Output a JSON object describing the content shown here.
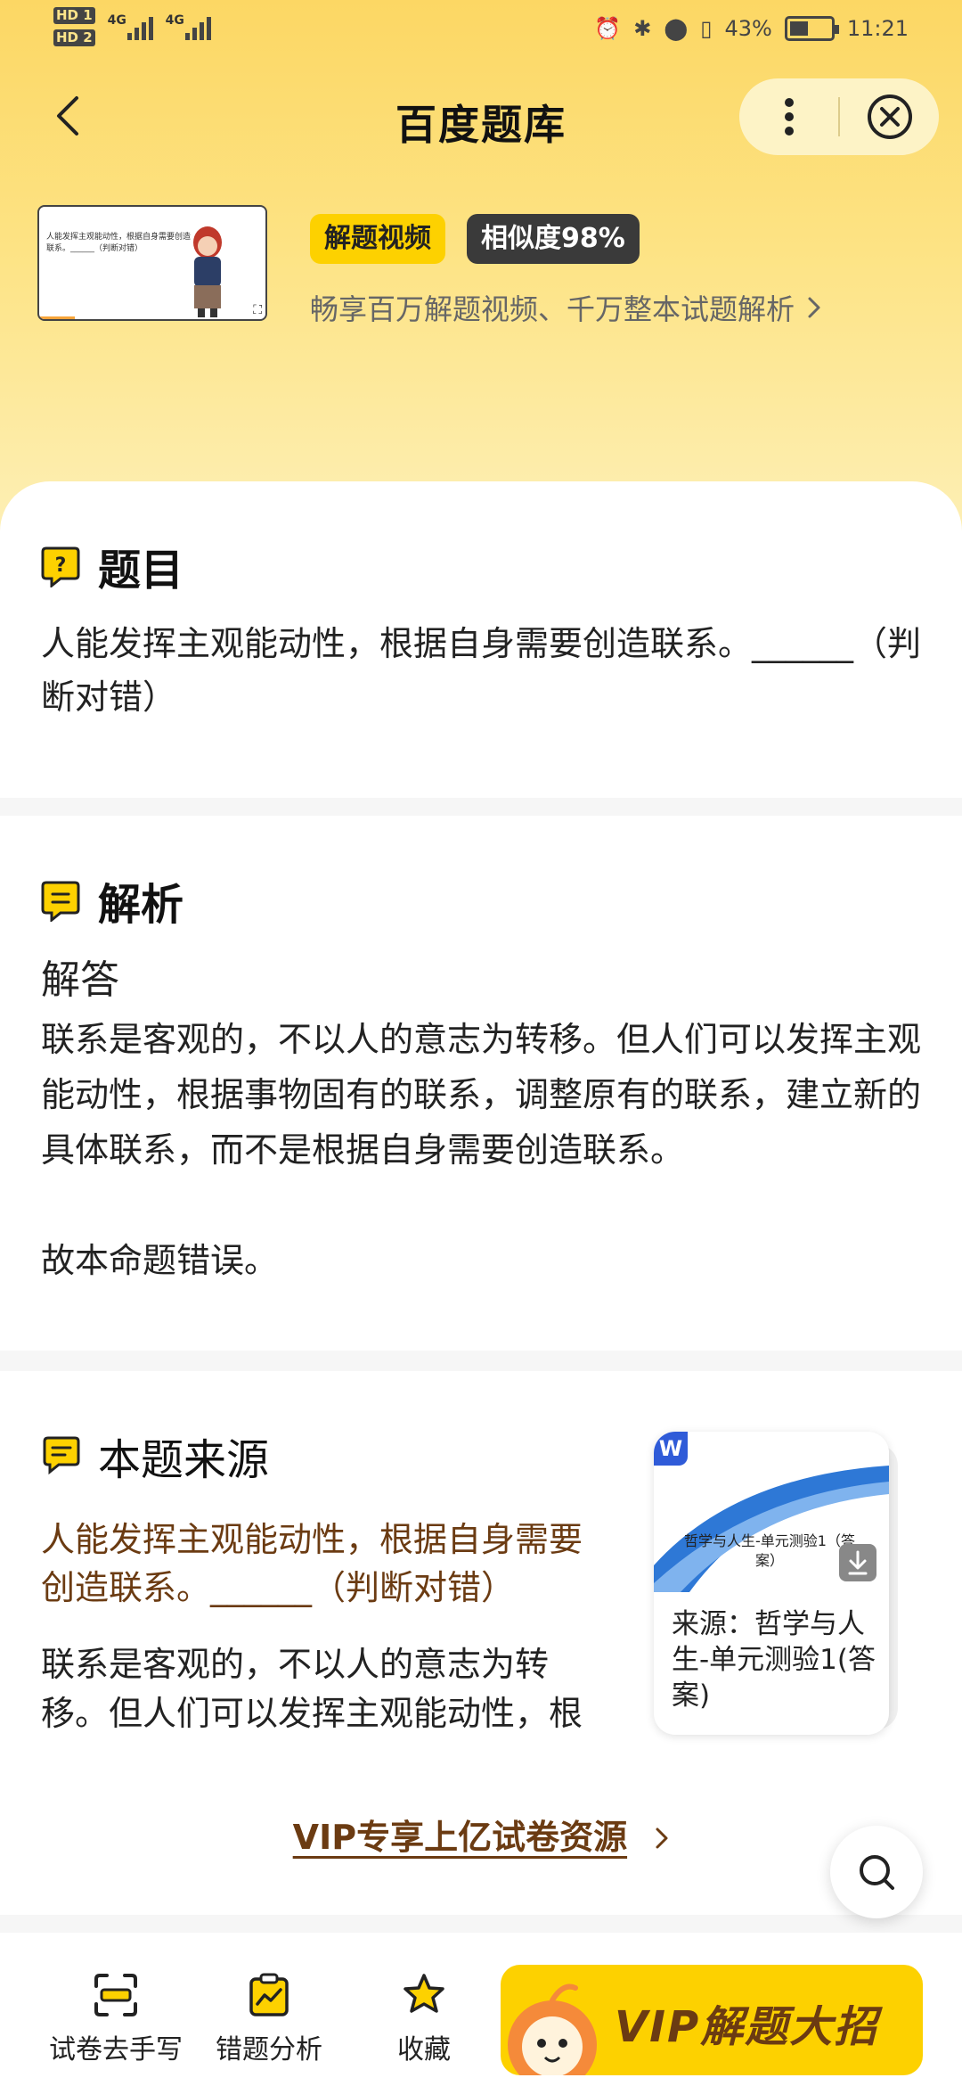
{
  "status_bar": {
    "hd1": "HD 1",
    "hd2": "HD 2",
    "net1": "4G",
    "net2": "4G",
    "battery": "43%",
    "time": "11:21"
  },
  "header": {
    "title": "百度题库",
    "back_icon": "chevron-left-icon",
    "more_icon": "more-vertical-icon",
    "close_icon": "close-circle-icon"
  },
  "video": {
    "thumb_text": "人能发挥主观能动性，根据自身需要创造联系。______（判断对错）",
    "tag_video": "解题视频",
    "tag_similarity": "相似度98%",
    "promo": "畅享百万解题视频、千万整本试题解析"
  },
  "question": {
    "heading": "题目",
    "text": "人能发挥主观能动性，根据自身需要创造联系。______（判断对错）"
  },
  "analysis": {
    "heading": "解析",
    "answer_label": "解答",
    "body": "联系是客观的，不以人的意志为转移。但人们可以发挥主观能动性，根据事物固有的联系，调整原有的联系，建立新的具体联系，而不是根据自身需要创造联系。",
    "conclusion": "故本命题错误。"
  },
  "source": {
    "heading": "本题来源",
    "stem": "人能发挥主观能动性，根据自身需要创造联系。______（判断对错）",
    "analysis_preview": "联系是客观的，不以人的意志为转移。但人们可以发挥主观能动性，根",
    "doc_badge": "W",
    "doc_cover_title": "哲学与人生-单元测验1（答案）",
    "doc_caption": "来源：哲学与人生-单元测验1(答案)"
  },
  "vip_link": "VIP专享上亿试卷资源",
  "bottom_bar": {
    "tabs": [
      {
        "label": "试卷去手写",
        "icon": "scan-icon"
      },
      {
        "label": "错题分析",
        "icon": "chart-clipboard-icon"
      },
      {
        "label": "收藏",
        "icon": "star-icon"
      }
    ],
    "vip_button": "VIP解题大招"
  },
  "colors": {
    "brand_yellow": "#fdd100",
    "header_gradient_top": "#fcd764",
    "source_text_brown": "#6b3b12"
  }
}
